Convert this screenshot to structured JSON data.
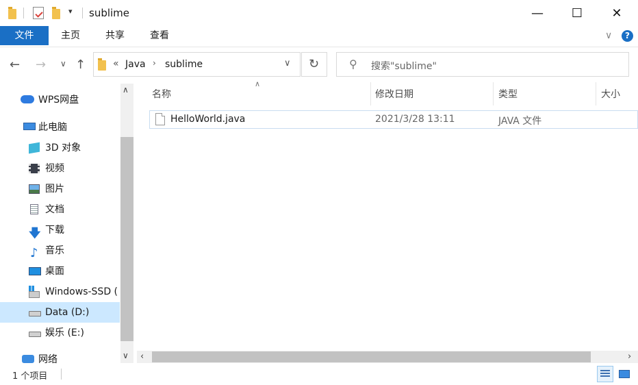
{
  "window": {
    "title": "sublime",
    "minimize": "—",
    "maximize": "☐",
    "close": "✕"
  },
  "ribbon": {
    "tabs": [
      "文件",
      "主页",
      "共享",
      "查看"
    ]
  },
  "address": {
    "overflow": "«",
    "crumbs": [
      "Java",
      "sublime"
    ]
  },
  "search": {
    "placeholder": "搜索\"sublime\""
  },
  "sidebar": {
    "items": [
      {
        "label": "WPS网盘",
        "icon": "cloud-icon"
      },
      {
        "label": "此电脑",
        "icon": "computer-icon"
      },
      {
        "label": "3D 对象",
        "icon": "cube-icon"
      },
      {
        "label": "视频",
        "icon": "video-icon"
      },
      {
        "label": "图片",
        "icon": "picture-icon"
      },
      {
        "label": "文档",
        "icon": "document-icon"
      },
      {
        "label": "下载",
        "icon": "download-icon"
      },
      {
        "label": "音乐",
        "icon": "music-icon"
      },
      {
        "label": "桌面",
        "icon": "desktop-icon"
      },
      {
        "label": "Windows-SSD (",
        "icon": "windows-drive-icon"
      },
      {
        "label": "Data (D:)",
        "icon": "drive-icon",
        "selected": true
      },
      {
        "label": "娱乐 (E:)",
        "icon": "drive-icon"
      },
      {
        "label": "网络",
        "icon": "network-icon"
      }
    ]
  },
  "columns": [
    "名称",
    "修改日期",
    "类型",
    "大小"
  ],
  "files": [
    {
      "name": "HelloWorld.java",
      "modified": "2021/3/28 13:11",
      "type": "JAVA 文件",
      "size": ""
    }
  ],
  "status": {
    "count": "1 个项目"
  },
  "colors": {
    "accent": "#1a6fc5",
    "folder": "#f2c14e",
    "selection": "#cce8ff"
  }
}
